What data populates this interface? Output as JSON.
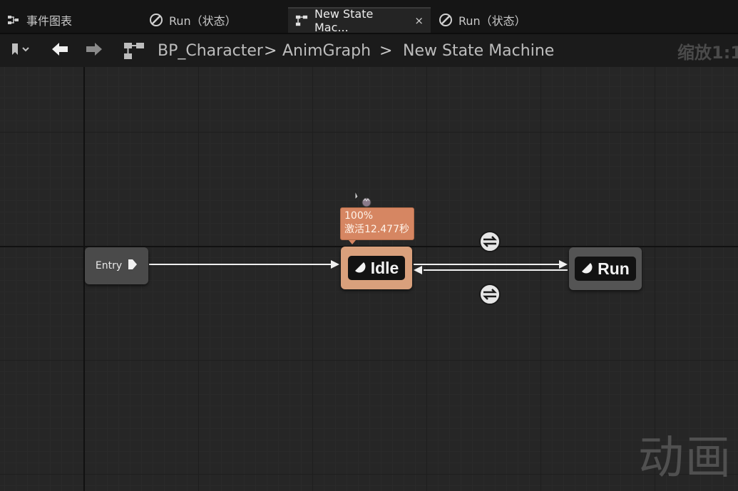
{
  "tabs": [
    {
      "label": "事件图表",
      "icon": "event-graph-icon",
      "active": false
    },
    {
      "label": "Run（状态）",
      "icon": "state-icon",
      "active": false
    },
    {
      "label": "New State Mac...",
      "icon": "state-machine-icon",
      "active": true,
      "close": "×"
    },
    {
      "label": "Run（状态）",
      "icon": "state-icon",
      "active": false
    }
  ],
  "toolbar": {
    "breadcrumbs": [
      "BP_Character",
      "AnimGraph",
      "New State Machine"
    ],
    "separator": ">",
    "zoom": "缩放1:1"
  },
  "graph": {
    "entry": {
      "label": "Entry"
    },
    "states": [
      {
        "label": "Idle",
        "active": true
      },
      {
        "label": "Run",
        "active": false
      }
    ],
    "tooltip": {
      "weight": "100%",
      "active_time": "激活12.477秒"
    }
  },
  "watermark": "动画",
  "colors": {
    "active_state": "#d9a07c",
    "inactive_state": "#545454",
    "tooltip_bg": "#d68662",
    "canvas_bg": "#262626"
  }
}
